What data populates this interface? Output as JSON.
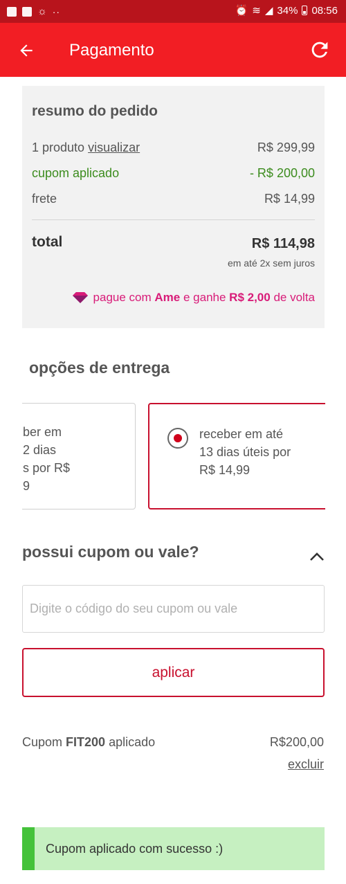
{
  "status_bar": {
    "battery": "34%",
    "time": "08:56",
    "dots": "··"
  },
  "app_bar": {
    "title": "Pagamento",
    "back_icon": "arrow-left-icon",
    "refresh_icon": "refresh-icon"
  },
  "summary": {
    "title": "resumo do pedido",
    "product_count": "1 produto",
    "view_link": "visualizar",
    "product_price": "R$ 299,99",
    "coupon_label": "cupom aplicado",
    "coupon_discount": "- R$ 200,00",
    "shipping_label": "frete",
    "shipping_price": "R$ 14,99",
    "total_label": "total",
    "total_value": "R$ 114,98",
    "installments": "em até 2x sem juros",
    "ame_prefix": "pague com",
    "ame_brand": "Ame",
    "ame_middle": "e ganhe",
    "ame_cashback": "R$ 2,00",
    "ame_suffix": "de volta"
  },
  "delivery": {
    "title": "opções de entrega",
    "options": [
      {
        "text": "ber em\n2 dias\ns por R$\n9",
        "selected": false
      },
      {
        "text": "receber em até 13 dias úteis por R$ 14,99",
        "selected": true
      }
    ]
  },
  "coupon": {
    "title": "possui cupom ou vale?",
    "input_value": "",
    "input_placeholder": "Digite o código do seu cupom ou vale",
    "apply_label": "aplicar",
    "applied_prefix": "Cupom",
    "applied_code": "FIT200",
    "applied_suffix": "aplicado",
    "applied_value": "R$200,00",
    "remove_label": "excluir"
  },
  "toast": {
    "message": "Cupom aplicado com sucesso :)"
  },
  "colors": {
    "status_bar": "#b8141c",
    "app_bar": "#f21e24",
    "accent_red": "#c8102e",
    "discount_green": "#3c8c1e",
    "ame_pink": "#d81b78",
    "toast_bg": "#c6f0c1",
    "toast_bar": "#44c23a"
  }
}
